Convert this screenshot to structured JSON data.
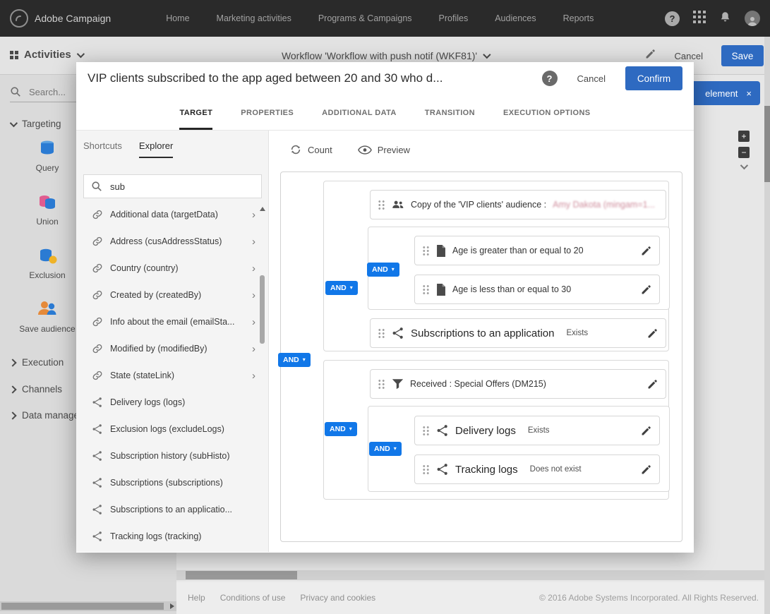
{
  "topbar": {
    "brand": "Adobe Campaign",
    "nav": [
      "Home",
      "Marketing activities",
      "Programs & Campaigns",
      "Profiles",
      "Audiences",
      "Reports"
    ]
  },
  "workflow_bar": {
    "section_label": "Activities",
    "title": "Workflow 'Workflow with push notif (WKF81)'",
    "cancel_label": "Cancel",
    "save_label": "Save"
  },
  "sidebar": {
    "search_placeholder": "Search...",
    "targeting_label": "Targeting",
    "items": [
      {
        "label": "Query"
      },
      {
        "label": "Union"
      },
      {
        "label": "Exclusion"
      },
      {
        "label": "Save audience"
      }
    ],
    "collapsed_sections": [
      {
        "label": "Execution"
      },
      {
        "label": "Channels"
      },
      {
        "label": "Data manage..."
      }
    ]
  },
  "canvas": {
    "element_button_label": "element",
    "zoom_in_label": "+",
    "zoom_out_label": "−"
  },
  "dialog": {
    "title": "VIP clients subscribed to the app aged between 20 and 30 who d...",
    "cancel_label": "Cancel",
    "confirm_label": "Confirm",
    "tabs": [
      {
        "label": "TARGET"
      },
      {
        "label": "PROPERTIES"
      },
      {
        "label": "ADDITIONAL DATA"
      },
      {
        "label": "TRANSITION"
      },
      {
        "label": "EXECUTION OPTIONS"
      }
    ],
    "explorer": {
      "shortcuts_tab": "Shortcuts",
      "explorer_tab": "Explorer",
      "search_value": "sub",
      "items": [
        {
          "label": "Additional data (targetData)"
        },
        {
          "label": "Address (cusAddressStatus)"
        },
        {
          "label": "Country (country)"
        },
        {
          "label": "Created by (createdBy)"
        },
        {
          "label": "Info about the email (emailSta..."
        },
        {
          "label": "Modified by (modifiedBy)"
        },
        {
          "label": "State (stateLink)"
        },
        {
          "label": "Delivery logs (logs)"
        },
        {
          "label": "Exclusion logs (excludeLogs)"
        },
        {
          "label": "Subscription history (subHisto)"
        },
        {
          "label": "Subscriptions (subscriptions)"
        },
        {
          "label": "Subscriptions to an applicatio..."
        },
        {
          "label": "Tracking logs (tracking)"
        }
      ]
    },
    "query_toolbar": {
      "count_label": "Count",
      "preview_label": "Preview"
    },
    "query": {
      "and_label": "AND",
      "audience_prefix": "Copy of the 'VIP clients' audience : ",
      "audience_value": "Amy Dakota (mingam=1...",
      "age_gte": "Age is greater than or equal to 20",
      "age_lte": "Age is less than or equal to 30",
      "subscriptions_label": "Subscriptions to an application",
      "subscriptions_op": "Exists",
      "received_label": "Received : Special Offers (DM215)",
      "delivery_label": "Delivery logs",
      "delivery_op": "Exists",
      "tracking_label": "Tracking logs",
      "tracking_op": "Does not exist"
    }
  },
  "footer": {
    "links": [
      {
        "label": "Help"
      },
      {
        "label": "Conditions of use"
      },
      {
        "label": "Privacy and cookies"
      }
    ],
    "copyright": "© 2016 Adobe Systems Incorporated. All Rights Reserved."
  }
}
